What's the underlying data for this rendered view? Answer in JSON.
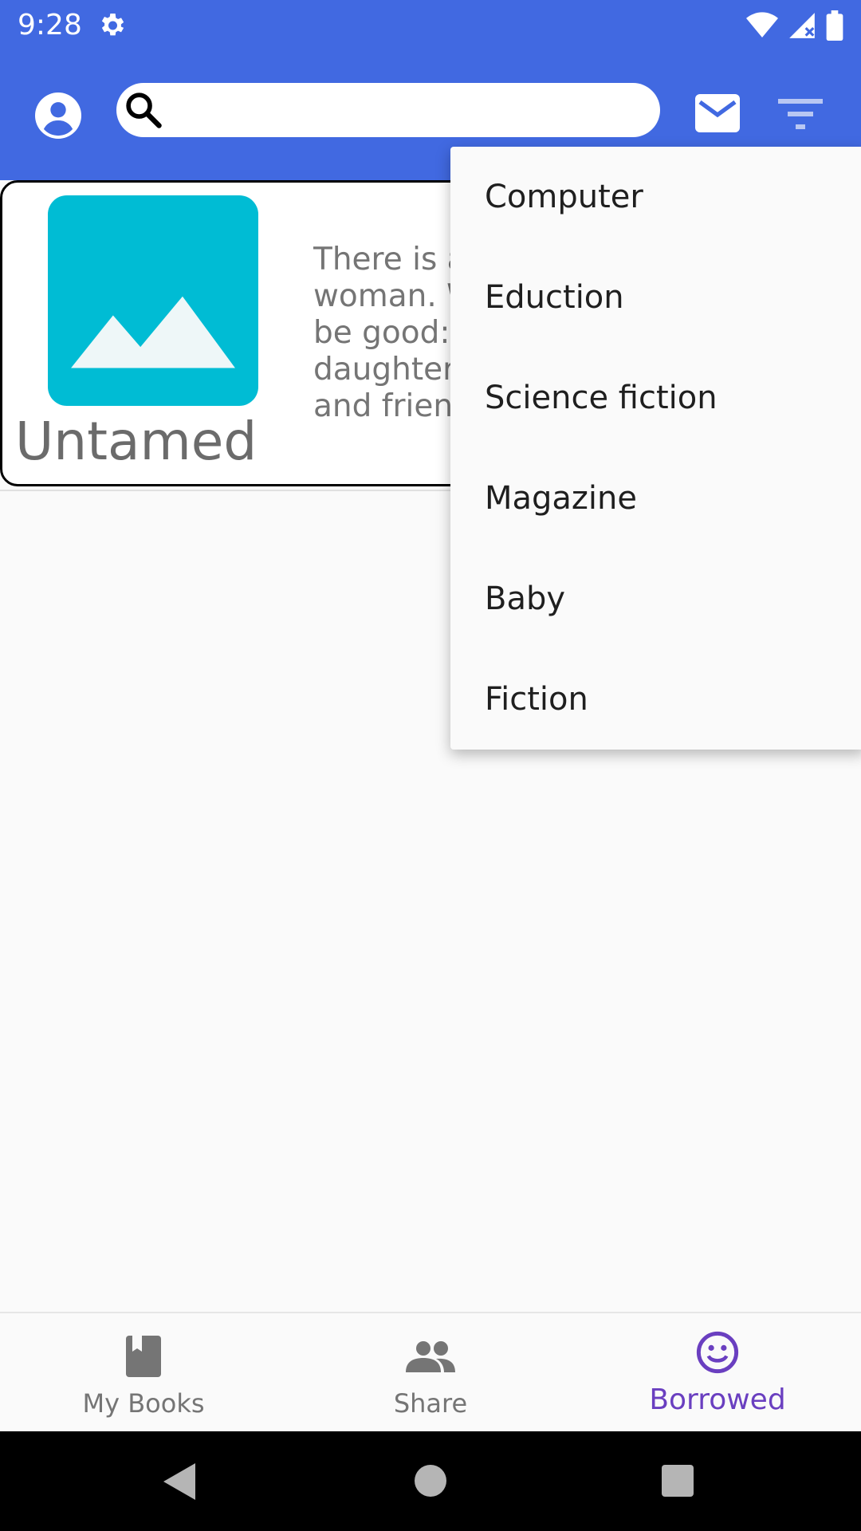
{
  "status_bar": {
    "time": "9:28"
  },
  "search": {
    "placeholder": ""
  },
  "book": {
    "title": "Untamed",
    "description": "There is a longing inside every woman. We strive so mightily to be good: good partners, daughters, mothers, employees and friends."
  },
  "filter_menu": {
    "items": [
      "Computer",
      "Eduction",
      "Science fiction",
      "Magazine",
      "Baby",
      "Fiction"
    ]
  },
  "bottom_nav": {
    "tabs": [
      {
        "label": "My Books",
        "active": false
      },
      {
        "label": "Share",
        "active": false
      },
      {
        "label": "Borrowed",
        "active": true
      }
    ]
  },
  "colors": {
    "app_bar": "#4169e1",
    "active_tab": "#6a3fc0",
    "thumbnail": "#00bcd4"
  }
}
